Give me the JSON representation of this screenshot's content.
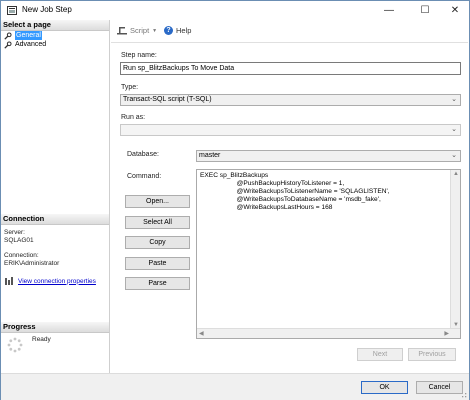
{
  "window": {
    "title": "New Job Step",
    "minimize": "—",
    "maximize": "☐",
    "close": "✕"
  },
  "sidebar": {
    "select_page_header": "Select a page",
    "pages": [
      {
        "label": "General",
        "selected": true
      },
      {
        "label": "Advanced",
        "selected": false
      }
    ],
    "connection_header": "Connection",
    "server_label": "Server:",
    "server_value": "SQLAG01",
    "connection_label": "Connection:",
    "connection_value": "ERIK\\Administrator",
    "view_connection_link": "View connection properties",
    "progress_header": "Progress",
    "progress_status": "Ready"
  },
  "toolbar": {
    "script_label": "Script",
    "help_label": "Help"
  },
  "form": {
    "step_name_label": "Step name:",
    "step_name_value": "Run sp_BlitzBackups To Move Data",
    "type_label": "Type:",
    "type_value": "Transact-SQL script (T-SQL)",
    "run_as_label": "Run as:",
    "run_as_value": "",
    "database_label": "Database:",
    "database_value": "master",
    "command_label": "Command:",
    "command_lines": [
      "EXEC sp_BlitzBackups",
      "                    @PushBackupHistoryToListener = 1,",
      "                    @WriteBackupsToListenerName = 'SQLAGLISTEN',",
      "                    @WriteBackupsToDatabaseName = 'msdb_fake',",
      "                    @WriteBackupsLastHours = 168"
    ]
  },
  "buttons": {
    "open": "Open...",
    "select_all": "Select All",
    "copy": "Copy",
    "paste": "Paste",
    "parse": "Parse",
    "next": "Next",
    "previous": "Previous",
    "ok": "OK",
    "cancel": "Cancel"
  }
}
